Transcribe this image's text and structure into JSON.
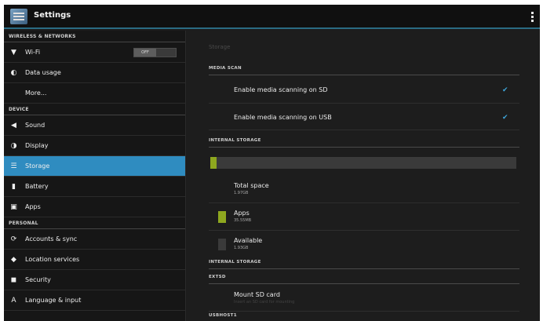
{
  "header": {
    "title": "Settings"
  },
  "sidebar": {
    "sections": [
      {
        "label": "WIRELESS & NETWORKS"
      },
      {
        "label": "DEVICE"
      },
      {
        "label": "PERSONAL"
      }
    ],
    "items": [
      {
        "label": "Wi-Fi",
        "icon": "wifi-icon",
        "toggle": "OFF"
      },
      {
        "label": "Data usage",
        "icon": "data-usage-icon"
      },
      {
        "label": "More..."
      },
      {
        "label": "Sound",
        "icon": "speaker-icon"
      },
      {
        "label": "Display",
        "icon": "display-icon"
      },
      {
        "label": "Storage",
        "icon": "storage-icon",
        "selected": true
      },
      {
        "label": "Battery",
        "icon": "battery-icon"
      },
      {
        "label": "Apps",
        "icon": "apps-icon"
      },
      {
        "label": "Accounts & sync",
        "icon": "sync-icon"
      },
      {
        "label": "Location services",
        "icon": "location-icon"
      },
      {
        "label": "Security",
        "icon": "lock-icon"
      },
      {
        "label": "Language & input",
        "icon": "language-icon"
      }
    ]
  },
  "main": {
    "title": "Storage",
    "media_scan": {
      "heading": "MEDIA SCAN",
      "sd_label": "Enable media scanning on SD",
      "usb_label": "Enable media scanning on USB"
    },
    "internal": {
      "heading": "INTERNAL STORAGE",
      "usage_fraction": 0.02,
      "total_label": "Total space",
      "total_value": "1.97GB",
      "apps_label": "Apps",
      "apps_value": "35.55MB",
      "available_label": "Available",
      "available_value": "1.93GB",
      "heading2": "INTERNAL STORAGE"
    },
    "extsd": {
      "heading": "EXTSD",
      "mount_label": "Mount SD card",
      "mount_sub": "Insert an SD card for mounting"
    },
    "usbhost": {
      "heading": "USBHOST1"
    }
  },
  "colors": {
    "accent": "#2f8cc0",
    "apps": "#8ea71f",
    "check": "#3ea4d8"
  }
}
